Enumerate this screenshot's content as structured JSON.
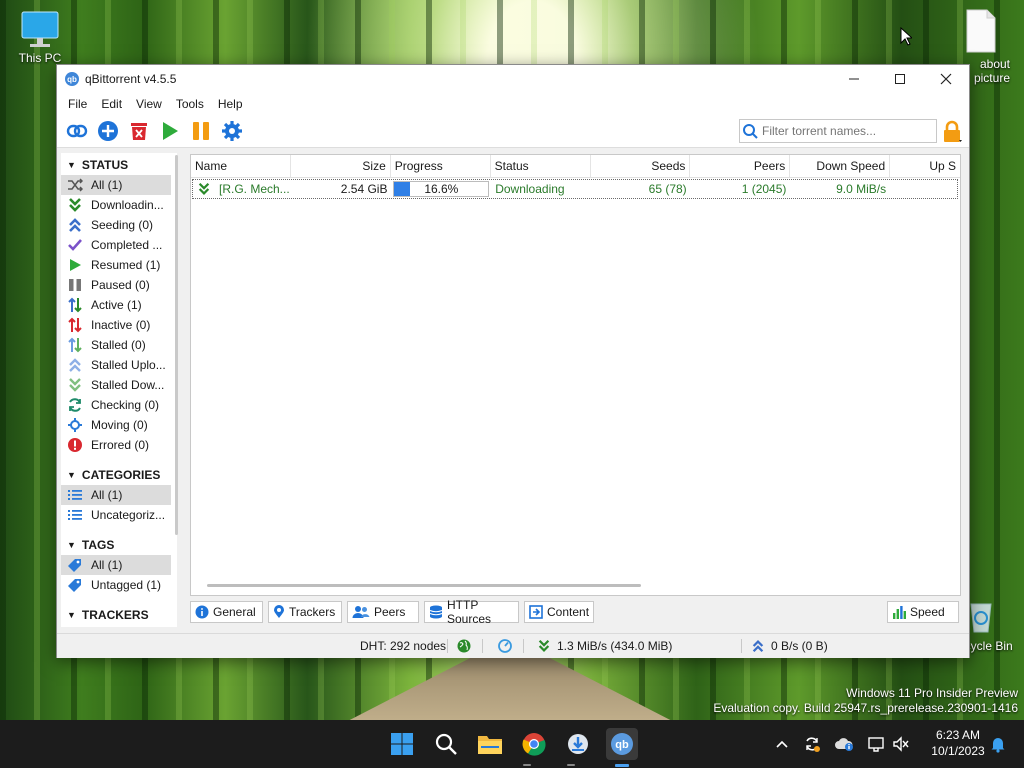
{
  "desktop": {
    "this_pc": "This PC",
    "file_label_1": "about",
    "file_label_2": "picture",
    "recycle_bin": "Recycle Bin",
    "watermark_line1": "Windows 11 Pro Insider Preview",
    "watermark_line2": "Evaluation copy. Build 25947.rs_prerelease.230901-1416"
  },
  "window": {
    "app_icon_text": "qb",
    "title": "qBittorrent v4.5.5",
    "minimize": "—",
    "maximize": "☐",
    "close": "✕"
  },
  "menu": [
    "File",
    "Edit",
    "View",
    "Tools",
    "Help"
  ],
  "toolbar": {
    "search_placeholder": "Filter torrent names..."
  },
  "sidebar": {
    "status_header": "STATUS",
    "status_items": [
      {
        "label": "All (1)",
        "icon": "shuffle-icon",
        "selected": true
      },
      {
        "label": "Downloadin...",
        "icon": "download-chevron-icon"
      },
      {
        "label": "Seeding (0)",
        "icon": "upload-chevron-icon"
      },
      {
        "label": "Completed ...",
        "icon": "checkmark-icon"
      },
      {
        "label": "Resumed (1)",
        "icon": "play-icon"
      },
      {
        "label": "Paused (0)",
        "icon": "pause-icon"
      },
      {
        "label": "Active (1)",
        "icon": "active-arrows-icon"
      },
      {
        "label": "Inactive (0)",
        "icon": "inactive-arrows-icon"
      },
      {
        "label": "Stalled (0)",
        "icon": "stalled-arrows-icon"
      },
      {
        "label": "Stalled Uplo...",
        "icon": "stalled-upload-icon"
      },
      {
        "label": "Stalled Dow...",
        "icon": "stalled-download-icon"
      },
      {
        "label": "Checking (0)",
        "icon": "refresh-icon"
      },
      {
        "label": "Moving (0)",
        "icon": "moving-icon"
      },
      {
        "label": "Errored (0)",
        "icon": "error-icon"
      }
    ],
    "categories_header": "CATEGORIES",
    "category_items": [
      {
        "label": "All (1)",
        "selected": true
      },
      {
        "label": "Uncategoriz..."
      }
    ],
    "tags_header": "TAGS",
    "tag_items": [
      {
        "label": "All (1)",
        "selected": true
      },
      {
        "label": "Untagged (1)"
      }
    ],
    "trackers_header": "TRACKERS"
  },
  "table": {
    "columns": [
      "Name",
      "Size",
      "Progress",
      "Status",
      "Seeds",
      "Peers",
      "Down Speed",
      "Up S"
    ],
    "rows": [
      {
        "name": "[R.G. Mech...",
        "size": "2.54 GiB",
        "progress": 0.166,
        "progress_text": "16.6%",
        "status": "Downloading",
        "seeds": "65 (78)",
        "peers": "1 (2045)",
        "down_speed": "9.0 MiB/s"
      }
    ]
  },
  "tabs": [
    "General",
    "Trackers",
    "Peers",
    "HTTP Sources",
    "Content"
  ],
  "speed_tab": "Speed",
  "statusbar": {
    "dht": "DHT: 292 nodes",
    "download": "1.3 MiB/s (434.0 MiB)",
    "upload": "0 B/s (0 B)"
  },
  "taskbar": {
    "time": "6:23 AM",
    "date": "10/1/2023"
  },
  "colors": {
    "accent_blue": "#1e73d8",
    "downloading_green": "#2a7a2a",
    "play_green": "#2eab3b",
    "pause_orange": "#f39c12",
    "delete_red": "#d9282f"
  }
}
